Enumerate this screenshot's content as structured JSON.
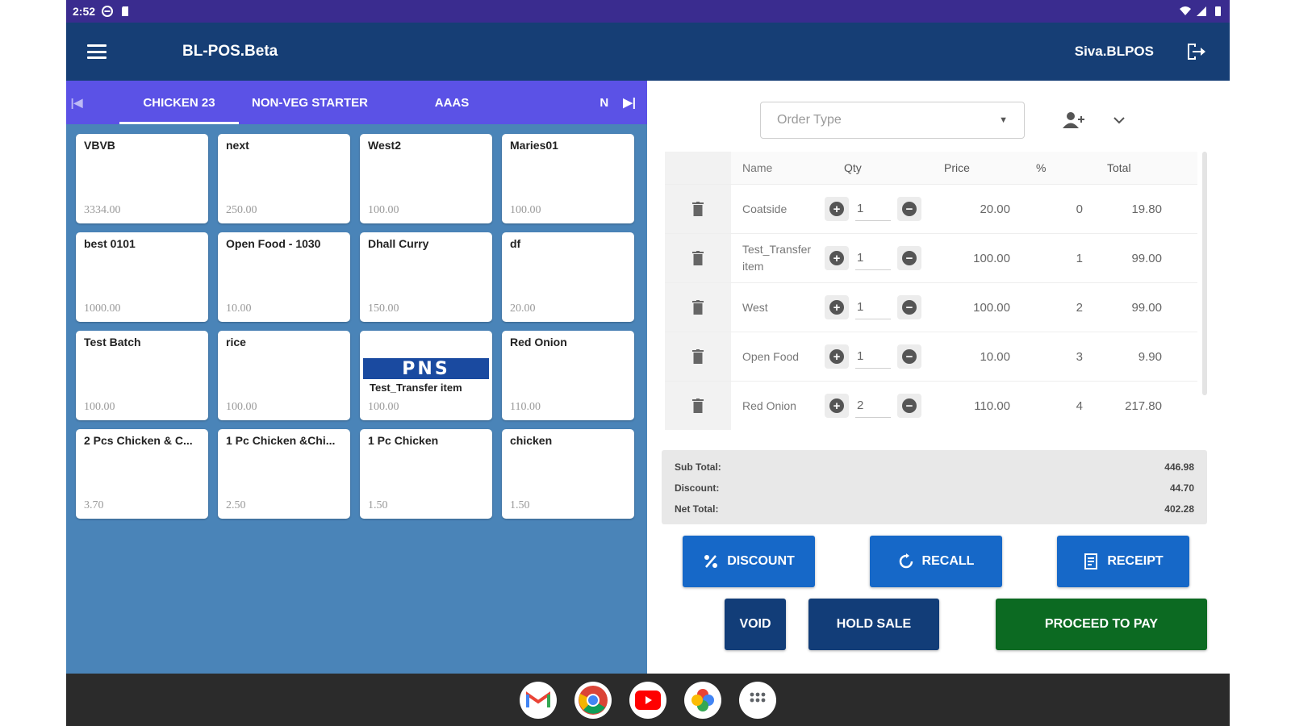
{
  "status_bar": {
    "time": "2:52"
  },
  "app_bar": {
    "title": "BL-POS.Beta",
    "user": "Siva.BLPOS"
  },
  "tabs": {
    "items": [
      {
        "label": "CHICKEN 23",
        "active": true
      },
      {
        "label": "NON-VEG STARTER",
        "active": false
      },
      {
        "label": "AAAS",
        "active": false
      },
      {
        "label": "N",
        "active": false
      }
    ]
  },
  "products": [
    {
      "name": "VBVB",
      "price": "3334.00"
    },
    {
      "name": "next",
      "price": "250.00"
    },
    {
      "name": "West2",
      "price": "100.00"
    },
    {
      "name": "Maries01",
      "price": "100.00"
    },
    {
      "name": "best 0101",
      "price": "1000.00"
    },
    {
      "name": "Open Food - 1030",
      "price": "10.00"
    },
    {
      "name": "Dhall Curry",
      "price": "150.00"
    },
    {
      "name": "df",
      "price": "20.00"
    },
    {
      "name": "Test Batch",
      "price": "100.00"
    },
    {
      "name": "rice",
      "price": "100.00"
    },
    {
      "name": "Test_Transfer item",
      "price": "100.00",
      "logo": "PNS"
    },
    {
      "name": "Red Onion",
      "price": "110.00"
    },
    {
      "name": "2 Pcs Chicken & C...",
      "price": "3.70"
    },
    {
      "name": "1 Pc Chicken &Chi...",
      "price": "2.50"
    },
    {
      "name": "1 Pc Chicken",
      "price": "1.50"
    },
    {
      "name": "chicken",
      "price": "1.50"
    }
  ],
  "order": {
    "order_type_placeholder": "Order Type",
    "headers": {
      "name": "Name",
      "qty": "Qty",
      "price": "Price",
      "pct": "%",
      "total": "Total"
    },
    "items": [
      {
        "name": "Coatside",
        "qty": "1",
        "price": "20.00",
        "pct": "0",
        "total": "19.80"
      },
      {
        "name": "Test_Transfer item",
        "qty": "1",
        "price": "100.00",
        "pct": "1",
        "total": "99.00"
      },
      {
        "name": "West",
        "qty": "1",
        "price": "100.00",
        "pct": "2",
        "total": "99.00"
      },
      {
        "name": "Open Food",
        "qty": "1",
        "price": "10.00",
        "pct": "3",
        "total": "9.90"
      },
      {
        "name": "Red Onion",
        "qty": "2",
        "price": "110.00",
        "pct": "4",
        "total": "217.80"
      }
    ]
  },
  "summary": {
    "subtotal_label": "Sub Total:",
    "subtotal": "446.98",
    "discount_label": "Discount:",
    "discount": "44.70",
    "net_label": "Net Total:",
    "net": "402.28"
  },
  "actions": {
    "discount": "DISCOUNT",
    "recall": "RECALL",
    "receipt": "RECEIPT",
    "void": "VOID",
    "hold": "HOLD SALE",
    "pay": "PROCEED TO PAY"
  },
  "colors": {
    "status_bar": "#3a2c8f",
    "app_bar": "#163e75",
    "tab_bar": "#5b52e6",
    "product_area": "#4a84b8",
    "action_blue": "#1668c8",
    "action_navy": "#123d78",
    "action_green": "#0c6a22"
  },
  "dock": {
    "apps": [
      "gmail-icon",
      "chrome-icon",
      "youtube-icon",
      "photos-icon",
      "app-drawer-icon"
    ]
  }
}
